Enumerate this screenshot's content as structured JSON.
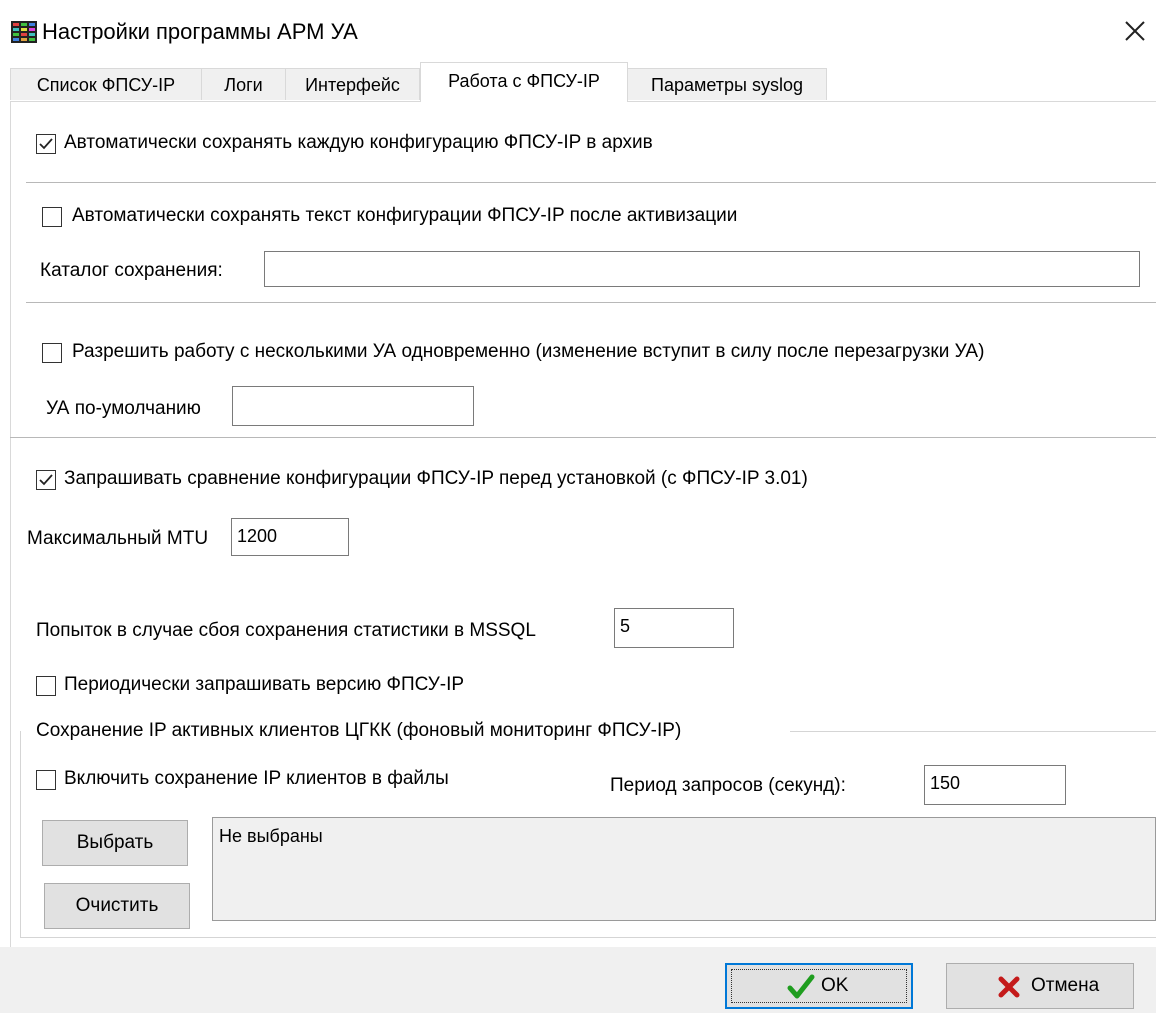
{
  "window": {
    "title": "Настройки программы АРМ УА",
    "app_icon": "app-grid-icon",
    "close_icon": "close-icon"
  },
  "tabs": [
    {
      "label": "Список ФПСУ-IP",
      "active": false
    },
    {
      "label": "Логи",
      "active": false
    },
    {
      "label": "Интерфейс",
      "active": false
    },
    {
      "label": "Работа с ФПСУ-IP",
      "active": true
    },
    {
      "label": "Параметры syslog",
      "active": false
    }
  ],
  "settings": {
    "auto_archive": {
      "label": "Автоматически сохранять каждую конфигурацию ФПСУ-IP в архив",
      "checked": true
    },
    "auto_save_text": {
      "label": "Автоматически сохранять текст конфигурации ФПСУ-IP после активизации",
      "checked": false
    },
    "save_dir": {
      "label": "Каталог сохранения:",
      "value": ""
    },
    "multi_ua": {
      "label": "Разрешить работу с несколькими УА одновременно (изменение вступит в силу после перезагрузки УА)",
      "checked": false
    },
    "default_ua": {
      "label": "УА по-умолчанию",
      "value": ""
    },
    "compare_request": {
      "label": "Запрашивать сравнение конфигурации ФПСУ-IP перед установкой (с ФПСУ-IP 3.01)",
      "checked": true
    },
    "max_mtu": {
      "label": "Максимальный MTU",
      "value": "1200"
    },
    "mssql_retries": {
      "label": "Попыток в случае сбоя сохранения статистики в MSSQL",
      "value": "5"
    },
    "poll_version": {
      "label": "Периодически запрашивать версию ФПСУ-IP",
      "checked": false
    }
  },
  "client_group": {
    "title": "Сохранение IP активных клиентов ЦГКК (фоновый мониторинг ФПСУ-IP)",
    "enable": {
      "label": "Включить сохранение IP клиентов в файлы",
      "checked": false
    },
    "period": {
      "label": "Период запросов (секунд):",
      "value": "150"
    },
    "select_label": "Выбрать",
    "clear_label": "Очистить",
    "files_text": "Не выбраны"
  },
  "footer": {
    "ok_label": "OK",
    "ok_icon": "checkmark-icon",
    "cancel_label": "Отмена",
    "cancel_icon": "red-x-icon"
  },
  "colors": {
    "check_green": "#1f9d1f",
    "cancel_red": "#c41a1a",
    "focus_border": "#0078d7"
  }
}
